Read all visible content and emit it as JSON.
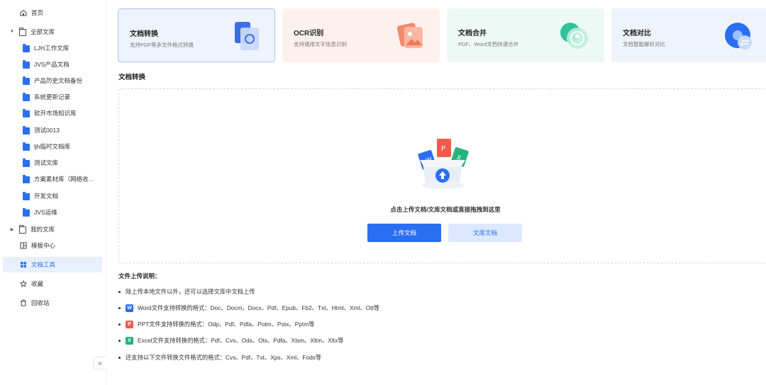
{
  "sidebar": {
    "items": [
      {
        "label": "首页"
      },
      {
        "label": "全部文库"
      },
      {
        "label": "LJH工作文库"
      },
      {
        "label": "JVS产品文档"
      },
      {
        "label": "产品历史文档备份"
      },
      {
        "label": "系统更新记录"
      },
      {
        "label": "软开市场知识库"
      },
      {
        "label": "测试0013"
      },
      {
        "label": "ljh临时文档库"
      },
      {
        "label": "测试文库"
      },
      {
        "label": "方案素材库（网络收…"
      },
      {
        "label": "开发文档"
      },
      {
        "label": "JVS运维"
      },
      {
        "label": "我的文库"
      },
      {
        "label": "模板中心"
      },
      {
        "label": "文档工具"
      },
      {
        "label": "收藏"
      },
      {
        "label": "回收站"
      }
    ],
    "collapse_icon": "«"
  },
  "cards": [
    {
      "title": "文档转换",
      "desc": "支持PDF等多文件格式转换"
    },
    {
      "title": "OCR识别",
      "desc": "支持通用文字信息识别"
    },
    {
      "title": "文档合并",
      "desc": "PDF、Word文档快速合并"
    },
    {
      "title": "文档对比",
      "desc": "文档智能解析对比"
    }
  ],
  "section_title": "文档转换",
  "upload": {
    "hint": "点击上传文档/文库文档或直接拖拽到这里",
    "upload_button": "上传文档",
    "library_button": "文库文档"
  },
  "notes": {
    "title": "文件上传说明：",
    "items": [
      {
        "text": "除上传本地文件以外，还可以选择文库中文档上传"
      },
      {
        "text": "Word文件支持转换的格式：Doc、Docm、Docx、Pdf、Epub、Fb2、Txt、Html、Xml、Ott等",
        "badge": "W"
      },
      {
        "text": "PPT文件支持转换的格式：Odp、Pdf、Pdfa、Potm、Potx、Pptm等",
        "badge": "P"
      },
      {
        "text": "Excel文件支持转换的格式：Pdf、Cvs、Ods、Ots、Pdfa、Xlsm、Xltm、Xltx等",
        "badge": "X"
      },
      {
        "text": "还支持以下文件转换文件格式的格式：Cvs、Pdf、Txt、Xps、Xml、Fods等"
      }
    ]
  },
  "colors": {
    "accent": "#2a6ff1",
    "word": "#2a6ff1",
    "ppt": "#f25b4c",
    "excel": "#25b57a"
  }
}
